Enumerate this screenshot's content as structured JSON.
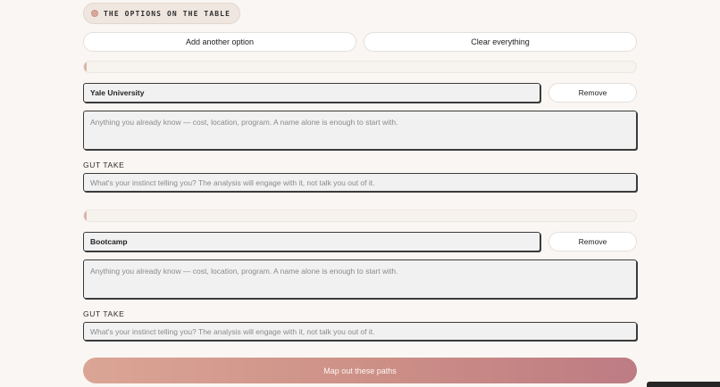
{
  "section": {
    "label": "THE OPTIONS ON THE TABLE"
  },
  "toolbar": {
    "add_label": "Add another option",
    "clear_label": "Clear everything"
  },
  "options": [
    {
      "name": "Yale University",
      "remove_label": "Remove",
      "notes_placeholder": "Anything you already know — cost, location, program. A name alone is enough to start with.",
      "gut_label": "GUT TAKE",
      "gut_placeholder": "What's your instinct telling you? The analysis will engage with it, not talk you out of it."
    },
    {
      "name": "Bootcamp",
      "remove_label": "Remove",
      "notes_placeholder": "Anything you already know — cost, location, program. A name alone is enough to start with.",
      "gut_label": "GUT TAKE",
      "gut_placeholder": "What's your instinct telling you? The analysis will engage with it, not talk you out of it."
    }
  ],
  "submit": {
    "label": "Map out these paths"
  },
  "colors": {
    "accent_start": "#dba595",
    "accent_end": "#bd7b84",
    "page_bg": "#f9f6f3"
  }
}
